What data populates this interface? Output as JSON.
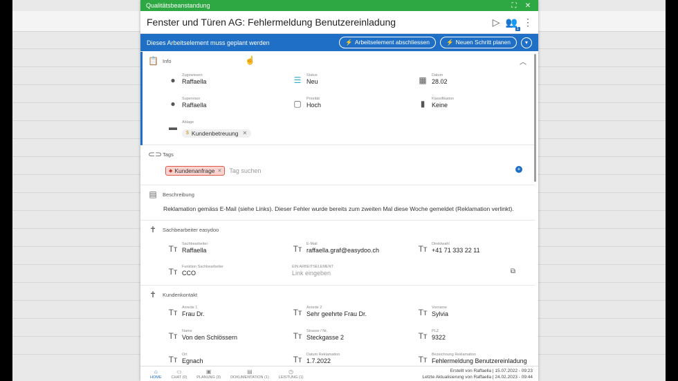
{
  "window": {
    "title": "Qualitätsbeanstandung"
  },
  "header": {
    "title": "Fenster und Türen AG: Fehlermeldung Benutzereinladung",
    "users_badge": "1"
  },
  "bluebar": {
    "text": "Dieses Arbeitselement muss geplant werden",
    "close_label": "Arbeitselement abschliessen",
    "plan_label": "Neuen Schritt planen"
  },
  "info": {
    "label": "Info",
    "zugewiesen": {
      "label": "Zugewiesen",
      "value": "Raffaella"
    },
    "status": {
      "label": "Status",
      "value": "Neu"
    },
    "datum": {
      "label": "Datum",
      "value": "28.02"
    },
    "supervisor": {
      "label": "Supervisor",
      "value": "Raffaella"
    },
    "prioritaet": {
      "label": "Priorität",
      "value": "Hoch"
    },
    "klassifikation": {
      "label": "Klassifikation",
      "value": "Keine"
    },
    "ablage": {
      "label": "Ablage",
      "value": "Kundenbetreuung"
    }
  },
  "tags": {
    "label": "Tags",
    "tag": "Kundenanfrage",
    "search_placeholder": "Tag suchen"
  },
  "beschreibung": {
    "label": "Beschreibung",
    "text": "Reklamation gemäss E-Mail (siehe Links). Dieser Fehler wurde bereits zum zweiten Mal diese Woche gemeldet (Reklamation verlinkt)."
  },
  "sachbearbeiter": {
    "label": "Sachbearbeiter easydoo",
    "name": {
      "label": "Sachbearbeiter",
      "value": "Raffaella"
    },
    "email": {
      "label": "E-Mail",
      "value": "raffaella.graf@easydoo.ch"
    },
    "direktwahl": {
      "label": "Direktwahl",
      "value": "+41 71 333 22 11"
    },
    "funktion": {
      "label": "Funktion Sachbearbeiter",
      "value": "CCO"
    },
    "link": {
      "label": "EIN ARBEITSELEMENT",
      "placeholder": "Link eingeben"
    }
  },
  "kundenkontakt": {
    "label": "Kundenkontakt",
    "anrede1": {
      "label": "Anrede 1",
      "value": "Frau Dr."
    },
    "anrede2": {
      "label": "Anrede 2",
      "value": "Sehr geehrte Frau Dr."
    },
    "vorname": {
      "label": "Vorname",
      "value": "Sylvia"
    },
    "name": {
      "label": "Name",
      "value": "Von den Schlössern"
    },
    "strasse": {
      "label": "Strasse / Nr.",
      "value": "Steckgasse 2"
    },
    "plz": {
      "label": "PLZ",
      "value": "9322"
    },
    "ort": {
      "label": "Ort",
      "value": "Egnach"
    },
    "datum_reklamation": {
      "label": "Datum Reklamation",
      "value": "1.7.2022"
    },
    "bezeichnung": {
      "label": "Bezeichnung Reklamation",
      "value": "Fehlermeldung Benutzereinladung"
    }
  },
  "bottomnav": {
    "home": "HOME",
    "chat": "CHAT (0)",
    "planung": "PLANUNG (3)",
    "dokumentation": "DOKUMENTATION (1)",
    "leistung": "LEISTUNG (1)",
    "erstellt": "Erstellt von Raffaella | 15.07.2022 - 09:23",
    "aktualisiert": "Letzte Aktualisierung von Raffaella | 24.02.2023 - 09:44"
  },
  "colors": {
    "title_green": "#2ea843",
    "action_blue": "#1f6fc7",
    "tag_red": "#e0574a"
  },
  "icons": [
    "play-circle-icon",
    "users-icon",
    "more-vert-icon",
    "clipboard-icon",
    "person-icon",
    "list-icon",
    "calendar-icon",
    "priority-icon",
    "book-icon",
    "folder-icon",
    "tag-icon",
    "add-circle-icon",
    "document-icon",
    "person-standing-icon",
    "text-type-icon",
    "external-link-icon"
  ]
}
